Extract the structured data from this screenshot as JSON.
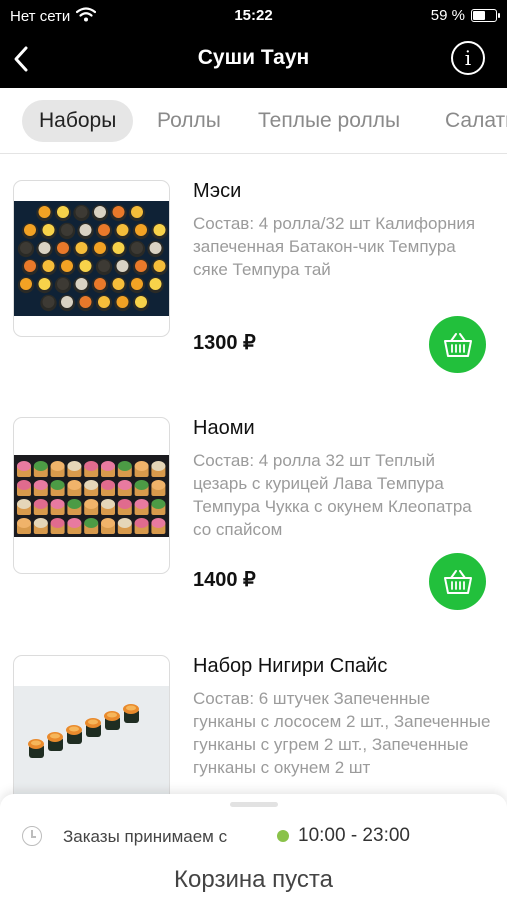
{
  "status_bar": {
    "carrier": "Нет сети",
    "time": "15:22",
    "battery_percent": "59 %",
    "battery_level": 0.59
  },
  "nav": {
    "title": "Суши Таун"
  },
  "tabs": [
    {
      "label": "Наборы",
      "active": true
    },
    {
      "label": "Роллы",
      "active": false
    },
    {
      "label": "Теплые роллы",
      "active": false
    },
    {
      "label": "Салаты",
      "active": false
    }
  ],
  "products": [
    {
      "name": "Мэси",
      "description": "Состав: 4 ролла/32 шт Калифорния запеченная Батакон-чик  Темпура сяке Темпура тай",
      "price": "1300 ₽"
    },
    {
      "name": "Наоми",
      "description": "Состав: 4 ролла 32 шт  Теплый цезарь с курицей  Лава Темпура  Темпура Чукка с окунем  Клеопатра со спайсом",
      "price": "1400 ₽"
    },
    {
      "name": "Набор Нигири Спайс",
      "description": "Состав: 6 штучек Запеченные гунканы с лососем 2 шт., Запеченные гунканы с угрем 2 шт., Запеченные гунканы с окунем 2 шт",
      "price": ""
    }
  ],
  "bottom_sheet": {
    "hours_label": "Заказы принимаем с",
    "hours_value": "10:00 - 23:00",
    "cart_status": "Корзина пуста"
  },
  "colors": {
    "accent_green": "#22c03c",
    "open_dot": "#8ac24a",
    "header_bg": "#000000"
  },
  "icons": [
    "wifi-icon",
    "battery-icon",
    "back-arrow-icon",
    "info-icon",
    "basket-icon",
    "clock-icon"
  ]
}
